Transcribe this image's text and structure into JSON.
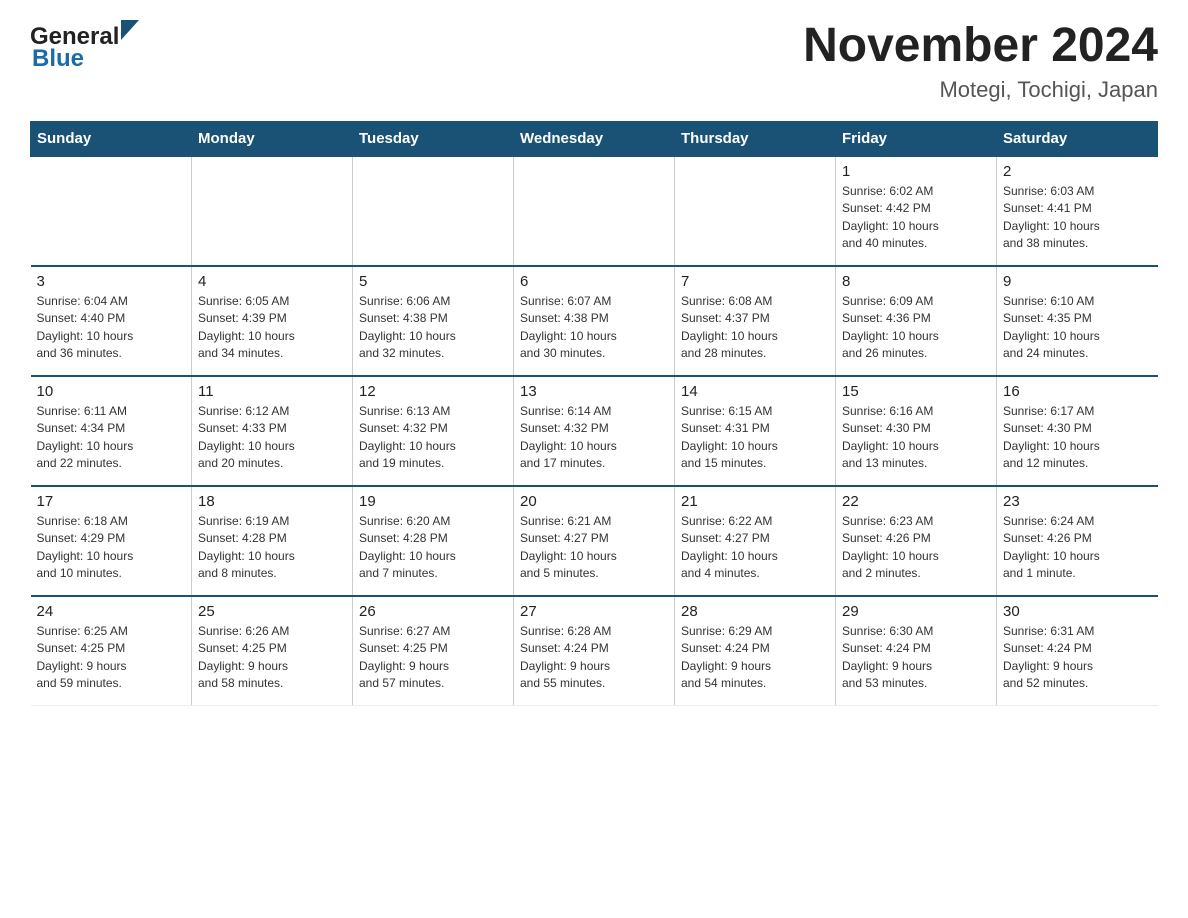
{
  "header": {
    "title": "November 2024",
    "subtitle": "Motegi, Tochigi, Japan",
    "logo_general": "General",
    "logo_blue": "Blue"
  },
  "days_of_week": [
    "Sunday",
    "Monday",
    "Tuesday",
    "Wednesday",
    "Thursday",
    "Friday",
    "Saturday"
  ],
  "weeks": [
    [
      {
        "day": "",
        "info": ""
      },
      {
        "day": "",
        "info": ""
      },
      {
        "day": "",
        "info": ""
      },
      {
        "day": "",
        "info": ""
      },
      {
        "day": "",
        "info": ""
      },
      {
        "day": "1",
        "info": "Sunrise: 6:02 AM\nSunset: 4:42 PM\nDaylight: 10 hours\nand 40 minutes."
      },
      {
        "day": "2",
        "info": "Sunrise: 6:03 AM\nSunset: 4:41 PM\nDaylight: 10 hours\nand 38 minutes."
      }
    ],
    [
      {
        "day": "3",
        "info": "Sunrise: 6:04 AM\nSunset: 4:40 PM\nDaylight: 10 hours\nand 36 minutes."
      },
      {
        "day": "4",
        "info": "Sunrise: 6:05 AM\nSunset: 4:39 PM\nDaylight: 10 hours\nand 34 minutes."
      },
      {
        "day": "5",
        "info": "Sunrise: 6:06 AM\nSunset: 4:38 PM\nDaylight: 10 hours\nand 32 minutes."
      },
      {
        "day": "6",
        "info": "Sunrise: 6:07 AM\nSunset: 4:38 PM\nDaylight: 10 hours\nand 30 minutes."
      },
      {
        "day": "7",
        "info": "Sunrise: 6:08 AM\nSunset: 4:37 PM\nDaylight: 10 hours\nand 28 minutes."
      },
      {
        "day": "8",
        "info": "Sunrise: 6:09 AM\nSunset: 4:36 PM\nDaylight: 10 hours\nand 26 minutes."
      },
      {
        "day": "9",
        "info": "Sunrise: 6:10 AM\nSunset: 4:35 PM\nDaylight: 10 hours\nand 24 minutes."
      }
    ],
    [
      {
        "day": "10",
        "info": "Sunrise: 6:11 AM\nSunset: 4:34 PM\nDaylight: 10 hours\nand 22 minutes."
      },
      {
        "day": "11",
        "info": "Sunrise: 6:12 AM\nSunset: 4:33 PM\nDaylight: 10 hours\nand 20 minutes."
      },
      {
        "day": "12",
        "info": "Sunrise: 6:13 AM\nSunset: 4:32 PM\nDaylight: 10 hours\nand 19 minutes."
      },
      {
        "day": "13",
        "info": "Sunrise: 6:14 AM\nSunset: 4:32 PM\nDaylight: 10 hours\nand 17 minutes."
      },
      {
        "day": "14",
        "info": "Sunrise: 6:15 AM\nSunset: 4:31 PM\nDaylight: 10 hours\nand 15 minutes."
      },
      {
        "day": "15",
        "info": "Sunrise: 6:16 AM\nSunset: 4:30 PM\nDaylight: 10 hours\nand 13 minutes."
      },
      {
        "day": "16",
        "info": "Sunrise: 6:17 AM\nSunset: 4:30 PM\nDaylight: 10 hours\nand 12 minutes."
      }
    ],
    [
      {
        "day": "17",
        "info": "Sunrise: 6:18 AM\nSunset: 4:29 PM\nDaylight: 10 hours\nand 10 minutes."
      },
      {
        "day": "18",
        "info": "Sunrise: 6:19 AM\nSunset: 4:28 PM\nDaylight: 10 hours\nand 8 minutes."
      },
      {
        "day": "19",
        "info": "Sunrise: 6:20 AM\nSunset: 4:28 PM\nDaylight: 10 hours\nand 7 minutes."
      },
      {
        "day": "20",
        "info": "Sunrise: 6:21 AM\nSunset: 4:27 PM\nDaylight: 10 hours\nand 5 minutes."
      },
      {
        "day": "21",
        "info": "Sunrise: 6:22 AM\nSunset: 4:27 PM\nDaylight: 10 hours\nand 4 minutes."
      },
      {
        "day": "22",
        "info": "Sunrise: 6:23 AM\nSunset: 4:26 PM\nDaylight: 10 hours\nand 2 minutes."
      },
      {
        "day": "23",
        "info": "Sunrise: 6:24 AM\nSunset: 4:26 PM\nDaylight: 10 hours\nand 1 minute."
      }
    ],
    [
      {
        "day": "24",
        "info": "Sunrise: 6:25 AM\nSunset: 4:25 PM\nDaylight: 9 hours\nand 59 minutes."
      },
      {
        "day": "25",
        "info": "Sunrise: 6:26 AM\nSunset: 4:25 PM\nDaylight: 9 hours\nand 58 minutes."
      },
      {
        "day": "26",
        "info": "Sunrise: 6:27 AM\nSunset: 4:25 PM\nDaylight: 9 hours\nand 57 minutes."
      },
      {
        "day": "27",
        "info": "Sunrise: 6:28 AM\nSunset: 4:24 PM\nDaylight: 9 hours\nand 55 minutes."
      },
      {
        "day": "28",
        "info": "Sunrise: 6:29 AM\nSunset: 4:24 PM\nDaylight: 9 hours\nand 54 minutes."
      },
      {
        "day": "29",
        "info": "Sunrise: 6:30 AM\nSunset: 4:24 PM\nDaylight: 9 hours\nand 53 minutes."
      },
      {
        "day": "30",
        "info": "Sunrise: 6:31 AM\nSunset: 4:24 PM\nDaylight: 9 hours\nand 52 minutes."
      }
    ]
  ]
}
